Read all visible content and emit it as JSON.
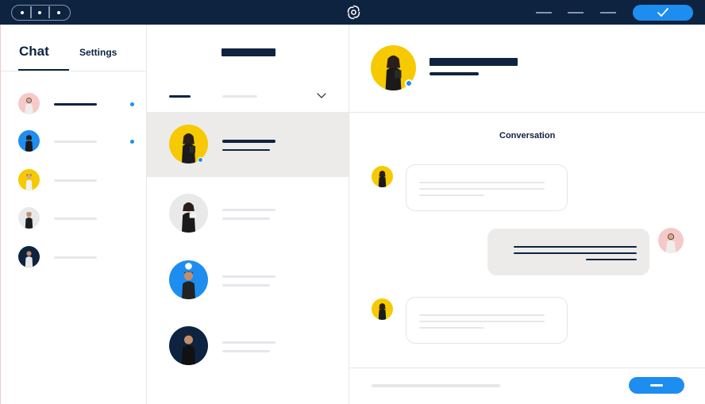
{
  "tabs": {
    "chat": "Chat",
    "settings": "Settings"
  },
  "conversation": {
    "title": "Conversation"
  },
  "colors": {
    "navy": "#0e2340",
    "accent": "#1e8df0",
    "yellow": "#f7c900",
    "pink": "#f6c9c9",
    "selected_bg": "#ecebea"
  },
  "icons": {
    "logo": "sprout-logo-icon",
    "confirm": "check-icon",
    "dropdown": "chevron-down-icon"
  }
}
